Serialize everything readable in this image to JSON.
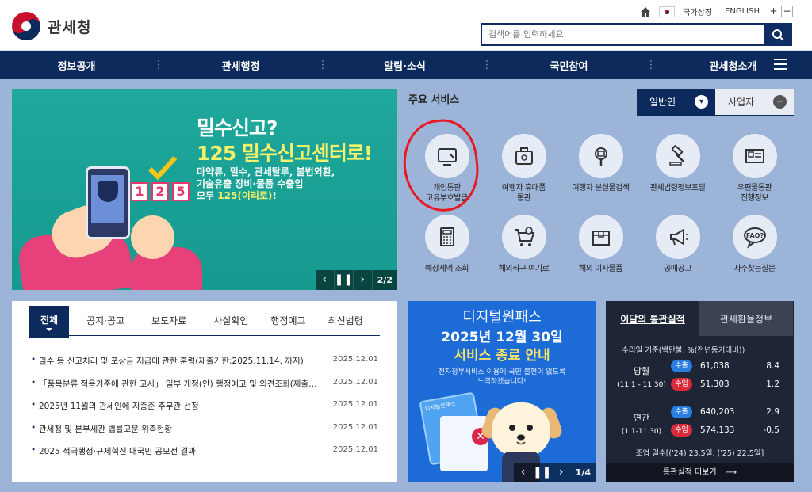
{
  "header": {
    "logo_text": "관세청",
    "util": {
      "symbol_label": "국가상징",
      "english_label": "ENGLISH",
      "zoom_in": "+",
      "zoom_out": "−"
    },
    "search_placeholder": "검색어를 입력하세요"
  },
  "gnb": {
    "items": [
      "정보공개",
      "관세행정",
      "알림·소식",
      "국민참여",
      "관세청소개"
    ]
  },
  "banner": {
    "title1": "밀수신고?",
    "title2": "125 밀수신고센터로!",
    "sub1": "마약류, 밀수, 관세탈루, 불법외환,",
    "sub2": "기술유출 장비·물품 수출입",
    "sub3_pre": "모두 ",
    "sub3_hl": "125(이리로)",
    "sub3_post": "!",
    "digits": [
      "1",
      "2",
      "5"
    ],
    "page": "2/2"
  },
  "services": {
    "title": "주요 서비스",
    "tab_general": "일반인",
    "tab_business": "사업자",
    "items": [
      {
        "label": "개인통관\n고유부호발급",
        "icon": "id-card-icon"
      },
      {
        "label": "여행자 휴대품\n통관",
        "icon": "luggage-icon"
      },
      {
        "label": "여행자 분실물검색",
        "icon": "magnifier-icon"
      },
      {
        "label": "관세법령정보포털",
        "icon": "gavel-icon"
      },
      {
        "label": "우편물통관\n진행정보",
        "icon": "mail-icon"
      },
      {
        "label": "예상세액 조회",
        "icon": "calculator-icon"
      },
      {
        "label": "해외직구 여기로",
        "icon": "cart-icon"
      },
      {
        "label": "해외 이사물품",
        "icon": "box-icon"
      },
      {
        "label": "공매공고",
        "icon": "megaphone-icon"
      },
      {
        "label": "자주찾는질문",
        "icon": "faq-icon"
      }
    ]
  },
  "notice": {
    "tabs": [
      "전체",
      "공지·공고",
      "보도자료",
      "사실확인",
      "행정예고",
      "최신법령"
    ],
    "rows": [
      {
        "title": "밀수 등 신고처리 및 포상금 지급에 관한 훈령(제출기한:2025.11.14. 까지)",
        "date": "2025.12.01"
      },
      {
        "title": "「품목분류 적용기준에 관한 고시」 일부 개정(안) 행정예고 및 의견조회(제출기...",
        "date": "2025.12.01"
      },
      {
        "title": "2025년 11월의 관세인에 지종준 주무관 선정",
        "date": "2025.12.01"
      },
      {
        "title": "관세청 및 본부세관 법률고문 위촉현황",
        "date": "2025.12.01"
      },
      {
        "title": "2025 적극행정·규제혁신 대국민 공모전 결과",
        "date": "2025.12.01"
      }
    ]
  },
  "dpass": {
    "title": "디지털원패스",
    "date": "2025년 12월 30일",
    "end": "서비스 종료 안내",
    "desc1": "전자정부서비스 이용에 국민 불편이 없도록",
    "desc2": "노력하겠습니다!",
    "card_label": "디지털원패스",
    "page": "1/4"
  },
  "stats": {
    "tab_on": "이달의 통관실적",
    "tab_off": "관세환율정보",
    "basis": "수리일 기준(백만불, %(전년동기대비))",
    "month": {
      "label": "당월",
      "period": "(11.1 - 11.30)",
      "export_label": "수출",
      "export_value": "61,038",
      "export_rate": "8.4",
      "import_label": "수입",
      "import_value": "51,303",
      "import_rate": "1.2"
    },
    "year": {
      "label": "연간",
      "period": "(1.1-11.30)",
      "export_label": "수출",
      "export_value": "640,203",
      "export_rate": "2.9",
      "import_label": "수입",
      "import_value": "574,133",
      "import_rate": "-0.5"
    },
    "days": "조업 일수[('24) 23.5일, ('25) 22.5일]",
    "more": "통관실적 더보기"
  },
  "colors": {
    "navy": "#0c2a5c",
    "background": "#9db4d9",
    "banner_teal": "#1fa89c",
    "highlight_red": "#e81923",
    "export_blue": "#2a7de1",
    "import_red": "#d92b3a"
  }
}
